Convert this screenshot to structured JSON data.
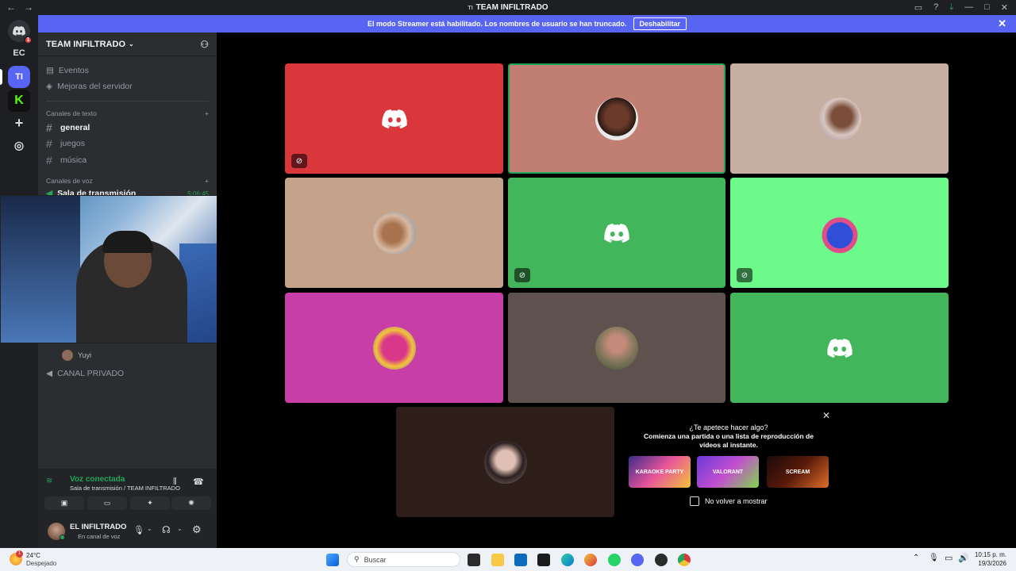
{
  "titlebar": {
    "title": "TEAM INFILTRADO",
    "server_tag": "TI"
  },
  "banner": {
    "text": "El modo Streamer está habilitado. Los nombres de usuario se han truncado.",
    "button": "Deshabilitar"
  },
  "guilds": [
    {
      "label": "EC"
    },
    {
      "label": "TI"
    },
    {
      "label": "K"
    }
  ],
  "guild_badges": {
    "home": "1"
  },
  "sidebar": {
    "server_name": "TEAM INFILTRADO",
    "events": "Eventos",
    "boosts": "Mejoras del servidor",
    "text_category": "Canales de texto",
    "text_channels": [
      "general",
      "juegos",
      "música"
    ],
    "voice_category": "Canales de voz",
    "voice_channel": "Sala de transmisión",
    "voice_timer": "5:06:45",
    "member_name": "Yuyi",
    "private_channel": "CANAL PRIVADO"
  },
  "voice_panel": {
    "status": "Voz conectada",
    "location": "Sala de transmisión / TEAM INFILTRADO"
  },
  "user": {
    "name": "EL INFILTRADO",
    "status": "En canal de voz"
  },
  "tiles_colors": [
    "#da373c",
    "#c17f73",
    "#c7aea3",
    "#c4a38a",
    "#43b55b",
    "#6cfb8b",
    "#c63ea6",
    "#5f524e",
    "#43b55b",
    "#2e1e19"
  ],
  "activity": {
    "title": "¿Te apetece hacer algo?",
    "subtitle": "Comienza una partida o una lista de reproducción de vídeos al instante.",
    "cards": [
      "KARAOKE PARTY",
      "VALORANT",
      "SCREAM"
    ],
    "checkbox": "No volver a mostrar"
  },
  "taskbar": {
    "weather_temp": "24°C",
    "weather_desc": "Despejado",
    "weather_badge": "1",
    "search": "Buscar",
    "time": "10:15 p. m.",
    "date": "19/3/2026"
  }
}
